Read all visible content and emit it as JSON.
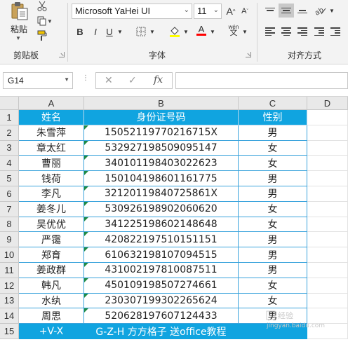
{
  "ribbon": {
    "paste_label": "粘贴",
    "clipboard_label": "剪贴板",
    "font_label": "字体",
    "align_label": "对齐方式",
    "font_name": "Microsoft YaHei UI",
    "font_size": "11",
    "grow_font": "A",
    "shrink_font": "A",
    "bold": "B",
    "italic": "I",
    "underline": "U",
    "font_color_glyph": "A",
    "phonetic_glyph": "wén",
    "accent_fill": "#FFFF00",
    "accent_font": "#FF0000"
  },
  "formula_bar": {
    "name_box": "G14",
    "cancel": "✕",
    "enter": "✓",
    "fx": "fx",
    "value": ""
  },
  "columns": [
    "A",
    "B",
    "C",
    "D"
  ],
  "rows": [
    "1",
    "2",
    "3",
    "4",
    "5",
    "6",
    "7",
    "8",
    "9",
    "10",
    "11",
    "12",
    "13",
    "14",
    "15"
  ],
  "table": {
    "headers": [
      "姓名",
      "身份证号码",
      "性别"
    ],
    "records": [
      [
        "朱雪萍",
        "15052119770216715X",
        "男"
      ],
      [
        "章太红",
        "532927198509095147",
        "女"
      ],
      [
        "曹丽",
        "340101198403022623",
        "女"
      ],
      [
        "钱荷",
        "150104198601161775",
        "男"
      ],
      [
        "李凡",
        "32120119840725861X",
        "男"
      ],
      [
        "姜冬儿",
        "530926198902060620",
        "女"
      ],
      [
        "吴优优",
        "341225198602148648",
        "女"
      ],
      [
        "严霭",
        "420822197510151151",
        "男"
      ],
      [
        "郑育",
        "610632198107094515",
        "男"
      ],
      [
        "姜政群",
        "431002197810087511",
        "男"
      ],
      [
        "韩凡",
        "450109198507274661",
        "女"
      ],
      [
        "水纨",
        "230307199302265624",
        "女"
      ],
      [
        "周思",
        "520628197607124433",
        "男"
      ]
    ],
    "footer": [
      "+V-X",
      "G-Z-H  方方格子  送office教程",
      ""
    ]
  },
  "colors": {
    "header_fill": "#10A4E0",
    "border": "#3AA3DC"
  }
}
